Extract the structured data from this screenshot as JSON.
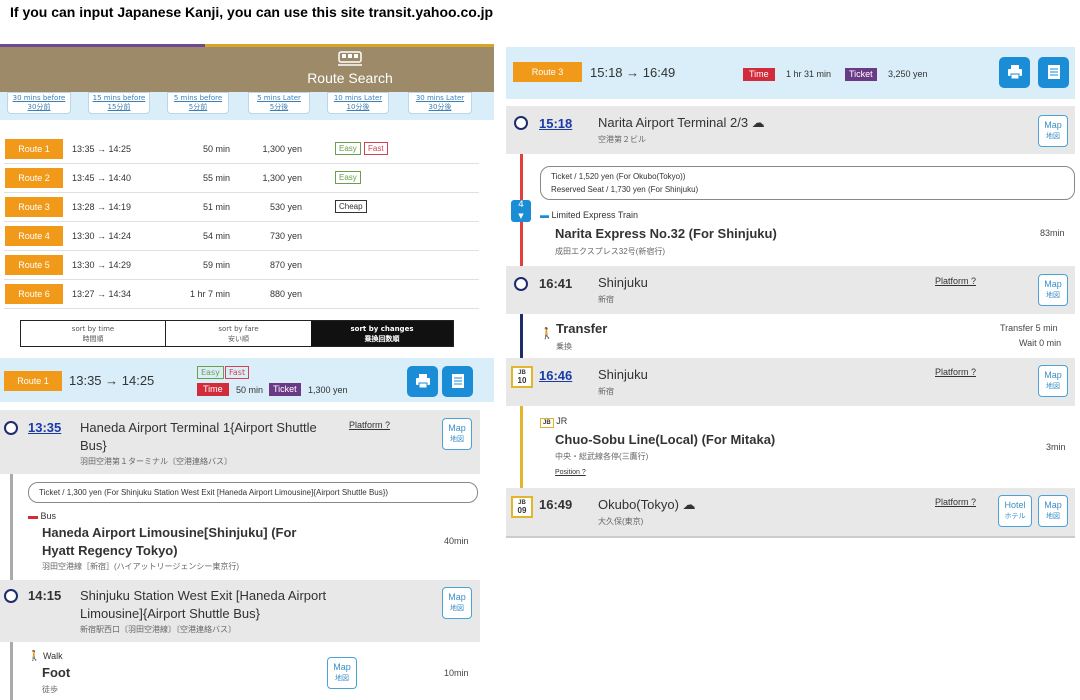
{
  "caption": "If you can input Japanese Kanji, you can use this site transit.yahoo.co.jp",
  "header": {
    "title": "Route Search",
    "train_icon": "train-icon"
  },
  "timeshift": [
    {
      "en": "30 mins before",
      "jp": "30分前"
    },
    {
      "en": "15 mins before",
      "jp": "15分前"
    },
    {
      "en": "5 mins before",
      "jp": "5分前"
    },
    {
      "en": "5 mins Later",
      "jp": "5分後"
    },
    {
      "en": "10 mins Later",
      "jp": "10分後"
    },
    {
      "en": "30 mins Later",
      "jp": "30分後"
    }
  ],
  "routes": [
    {
      "label": "Route 1",
      "time": "13:35 → 14:25",
      "duration": "50 min",
      "fare": "1,300 yen"
    },
    {
      "label": "Route 2",
      "time": "13:45 → 14:40",
      "duration": "55 min",
      "fare": "1,300 yen"
    },
    {
      "label": "Route 3",
      "time": "13:28 → 14:19",
      "duration": "51 min",
      "fare": "530 yen"
    },
    {
      "label": "Route 4",
      "time": "13:30 → 14:24",
      "duration": "54 min",
      "fare": "730 yen"
    },
    {
      "label": "Route 5",
      "time": "13:30 → 14:29",
      "duration": "59 min",
      "fare": "870 yen"
    },
    {
      "label": "Route 6",
      "time": "13:27 → 14:34",
      "duration": "1 hr 7 min",
      "fare": "880 yen"
    }
  ],
  "badges": {
    "easy": "Easy",
    "fast": "Fast",
    "cheap": "Cheap"
  },
  "sort": [
    {
      "en": "sort by time",
      "jp": "時間順"
    },
    {
      "en": "sort by fare",
      "jp": "安い順"
    },
    {
      "en": "sort by changes",
      "jp": "乗換回数順"
    }
  ],
  "route1": {
    "label": "Route 1",
    "time": "13:35 → 14:25",
    "time_chip": "Time",
    "duration": "50 min",
    "ticket_chip": "Ticket",
    "fare": "1,300 yen",
    "stop1": {
      "time": "13:35",
      "name": "Haneda Airport Terminal 1{Airport Shuttle Bus}",
      "jp": "羽田空港第１ターミナル〔空港連絡バス〕",
      "platform": "Platform ?"
    },
    "ticket": "Ticket / 1,300 yen (For Shinjuku Station West Exit [Haneda Airport Limousine]{Airport Shuttle Bus})",
    "bus_mode": "Bus",
    "bus_line": "Haneda Airport Limousine[Shinjuku] (For Hyatt Regency Tokyo)",
    "bus_line_jp": "羽田空港線［新宿］(ハイアットリージェンシー東京行)",
    "bus_dur": "40min",
    "stop2": {
      "time": "14:15",
      "name": "Shinjuku Station West Exit [Haneda Airport Limousine]{Airport Shuttle Bus}",
      "jp": "新宿駅西口〔羽田空港線〕〔空港連絡バス〕"
    },
    "walk_mode": "Walk",
    "walk_line": "Foot",
    "walk_jp": "徒歩",
    "walk_dur": "10min"
  },
  "map": {
    "en": "Map",
    "jp": "地図"
  },
  "hotel": {
    "en": "Hotel",
    "jp": "ホテル"
  },
  "route3": {
    "label": "Route 3",
    "time": "15:18 → 16:49",
    "time_chip": "Time",
    "duration": "1 hr 31 min",
    "ticket_chip": "Ticket",
    "fare": "3,250 yen",
    "stop1": {
      "time": "15:18",
      "name": "Narita Airport Terminal 2/3",
      "jp": "空港第２ビル"
    },
    "ticket1": "Ticket / 1,520 yen (For Okubo(Tokyo))",
    "ticket2": "Reserved Seat / 1,730 yen (For Shinjuku)",
    "track": "4",
    "train_mode": "Limited Express Train",
    "train_line": "Narita Express No.32 (For Shinjuku)",
    "train_jp": "成田エクスプレス32号(新宿行)",
    "train_dur": "83min",
    "stop2": {
      "time": "16:41",
      "name": "Shinjuku",
      "jp": "新宿",
      "platform": "Platform ?"
    },
    "transfer": "Transfer",
    "transfer_jp": "乗換",
    "transfer_time": "Transfer 5 min",
    "wait_time": "Wait 0 min",
    "stop3": {
      "time": "16:46",
      "name": "Shinjuku",
      "jp": "新宿",
      "platform": "Platform ?",
      "code_line": "JB",
      "code_num": "10"
    },
    "jr_mode": "JR",
    "jr_code": "JB",
    "jr_line": "Chuo-Sobu Line(Local) (For Mitaka)",
    "jr_jp": "中央・総武線各停(三鷹行)",
    "position": "Position ?",
    "jr_dur": "3min",
    "stop4": {
      "time": "16:49",
      "name": "Okubo(Tokyo)",
      "jp": "大久保(東京)",
      "platform": "Platform ?",
      "code_line": "JB",
      "code_num": "09"
    }
  },
  "colors": {
    "orange": "#f19a1a",
    "time_red": "#d12b3c",
    "ticket_purple": "#6b3a86",
    "accent_blue": "#1a8dd6",
    "narita_red": "#e2403a",
    "jr_yellow": "#e3b52a"
  }
}
